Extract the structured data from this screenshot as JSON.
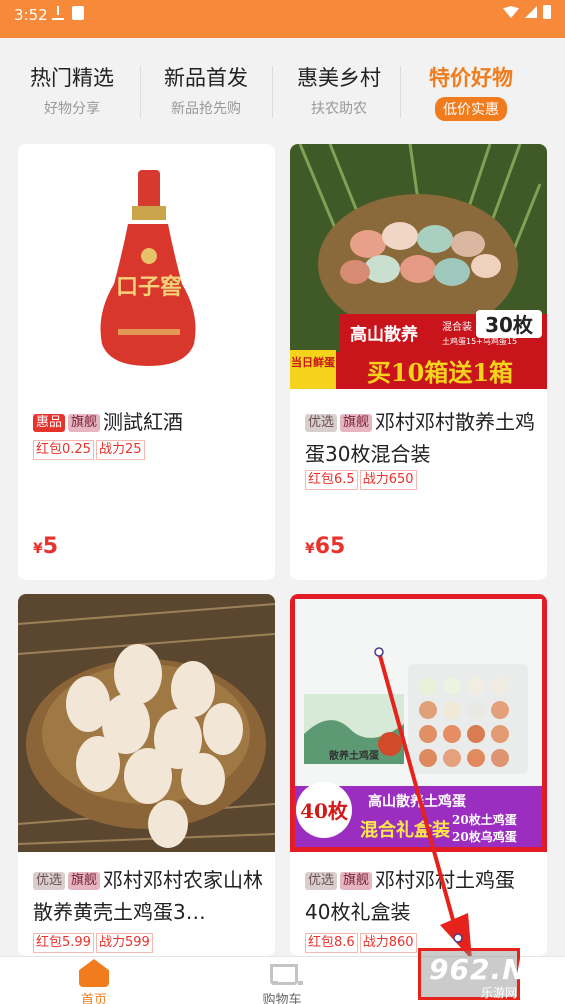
{
  "status": {
    "time": "3:52"
  },
  "tabs": [
    {
      "title": "热门精选",
      "subtitle": "好物分享"
    },
    {
      "title": "新品首发",
      "subtitle": "新品抢先购"
    },
    {
      "title": "惠美乡村",
      "subtitle": "扶农助农"
    },
    {
      "title": "特价好物",
      "subtitle": "低价实惠"
    }
  ],
  "products": [
    {
      "badges": [
        "惠品",
        "旗舰"
      ],
      "title": "测試紅酒",
      "tags": [
        "红包0.25",
        "战力25"
      ],
      "price": "5",
      "bottle_label": "口子窖"
    },
    {
      "badges": [
        "优选",
        "旗舰"
      ],
      "title": "邓村邓村散养土鸡蛋30枚混合装",
      "tags": [
        "红包6.5",
        "战力650"
      ],
      "price": "65",
      "image_text": {
        "brand": "高山散养",
        "count": "30枚",
        "mix_title": "混合装",
        "mix_detail": "土鸡蛋15+乌鸡蛋15",
        "fresh": "当日鲜蛋",
        "promo": "买10箱送1箱"
      }
    },
    {
      "badges": [
        "优选",
        "旗舰"
      ],
      "title": "邓村邓村农家山林散养黄壳土鸡蛋3…",
      "tags": [
        "红包5.99",
        "战力599"
      ],
      "price": ""
    },
    {
      "badges": [
        "优选",
        "旗舰"
      ],
      "title": "邓村邓村土鸡蛋40枚礼盒装",
      "tags": [
        "红包8.6",
        "战力860"
      ],
      "price": "",
      "image_text": {
        "count": "40枚",
        "line1": "高山散养土鸡蛋",
        "line2": "混合礼盒装",
        "detail1": "20枚土鸡蛋",
        "detail2": "20枚乌鸡蛋",
        "box_label": "散养土鸡蛋"
      }
    }
  ],
  "currency": "¥",
  "bottom_nav": [
    {
      "label": "首页"
    },
    {
      "label": "购物车"
    }
  ],
  "watermark": {
    "main": "962.NET",
    "sub": "乐游网"
  },
  "colors": {
    "accent": "#f07c1e",
    "statusbar": "#f78a3a",
    "price": "#e8322c"
  }
}
